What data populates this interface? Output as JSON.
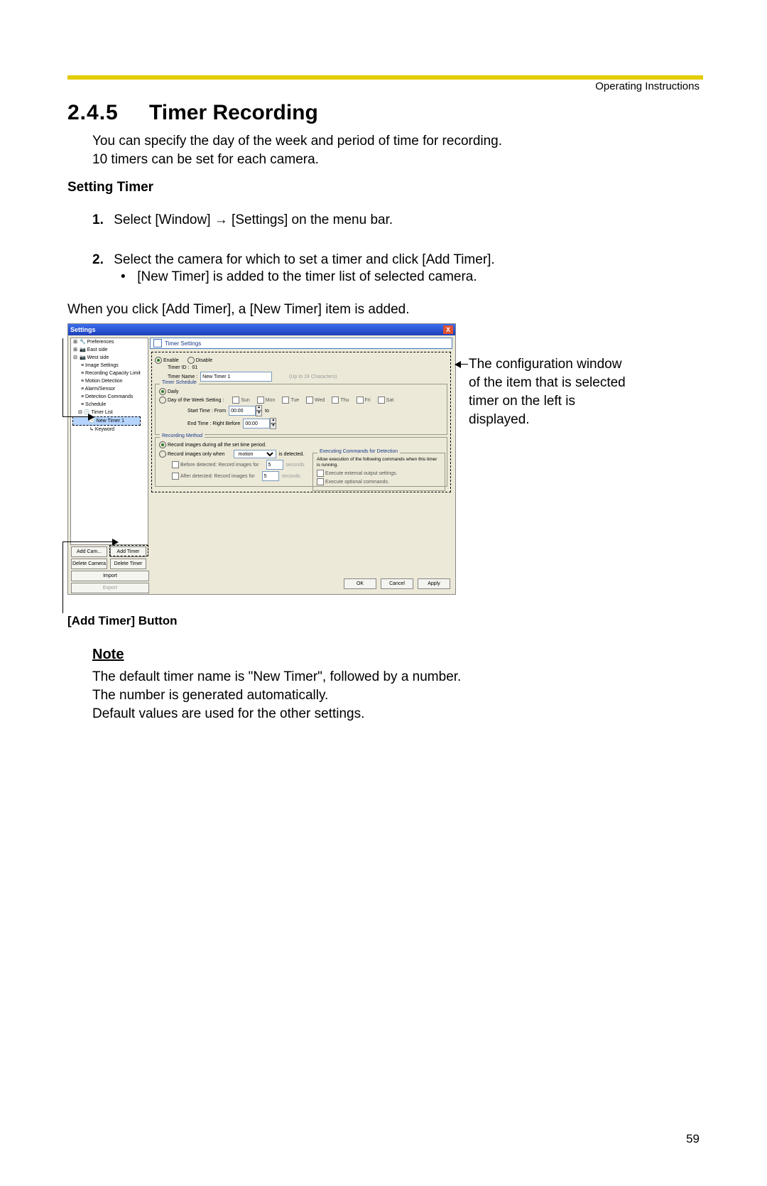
{
  "header": {
    "right": "Operating Instructions"
  },
  "section": {
    "number": "2.4.5",
    "title": "Timer Recording"
  },
  "intro": {
    "l1": "You can specify the day of the week and period of time for recording.",
    "l2": "10 timers can be set for each camera."
  },
  "subheading": "Setting Timer",
  "steps": {
    "s1": "Select [Window] → [Settings] on the menu bar.",
    "s2": "Select the camera for which to set a timer and click [Add Timer].",
    "s2b": "[New Timer] is added to the timer list of selected camera."
  },
  "when_line": "When you click [Add Timer], a [New Timer] item is added.",
  "annotation_right": "The configuration window of the item that is selected timer on the left is displayed.",
  "addtimer_caption": "[Add Timer] Button",
  "note": {
    "heading": "Note",
    "l1": "The default timer name is \"New Timer\", followed by a number.",
    "l2": "The number is generated automatically.",
    "l3": "Default values are used for the other settings."
  },
  "page_number": "59",
  "dialog": {
    "title": "Settings",
    "close": "X",
    "tree": {
      "preferences": "Preferences",
      "east": "East side",
      "west": "West side",
      "img": "Image Settings",
      "cap": "Recording Capacity Limit",
      "mot": "Motion Detection",
      "alm": "Alarm/Sensor",
      "detcmd": "Detection Commands",
      "schedule": "Schedule",
      "timerlist": "Timer List",
      "newtimer": "New Timer 1",
      "keyword": "Keyword"
    },
    "panel_title": "Timer Settings",
    "enable": "Enable",
    "disable": "Disable",
    "timer_id_label": "Timer ID :",
    "timer_id_value": "01",
    "timer_name_label": "Timer Name :",
    "timer_name_value": "New Timer 1",
    "timer_name_hint": "(Up to 24 Characters)",
    "schedule": {
      "group": "Timer Schedule",
      "daily": "Daily",
      "dow_label": "Day of the Week Setting :",
      "days": [
        "Sun",
        "Mon",
        "Tue",
        "Wed",
        "Thu",
        "Fri",
        "Sat"
      ],
      "start_label": "Start Time : From",
      "start_value": "00:00",
      "to": "to",
      "end_label": "End Time : Right Before",
      "end_value": "00:00"
    },
    "recording": {
      "group": "Recording Method",
      "opt1": "Record images during all the set time period.",
      "opt2_pre": "Record images only when",
      "opt2_sel": "motion",
      "opt2_post": "is detected.",
      "before_label": "Before detected: Record images for",
      "after_label": "After     detected: Record images for",
      "num": "5",
      "unit": "seconds",
      "cmds_group": "Executing Commands for Detection",
      "cmds_desc": "Allow execution of the following commands when this timer is running.",
      "cmd1": "Execute external output settings.",
      "cmd2": "Execute optional commands."
    },
    "buttons": {
      "add_cam": "Add Cam...",
      "add_timer": "Add Timer",
      "del_cam": "Delete Camera",
      "del_timer": "Delete Timer",
      "import": "Import",
      "export": "Export",
      "ok": "OK",
      "cancel": "Cancel",
      "apply": "Apply"
    }
  }
}
